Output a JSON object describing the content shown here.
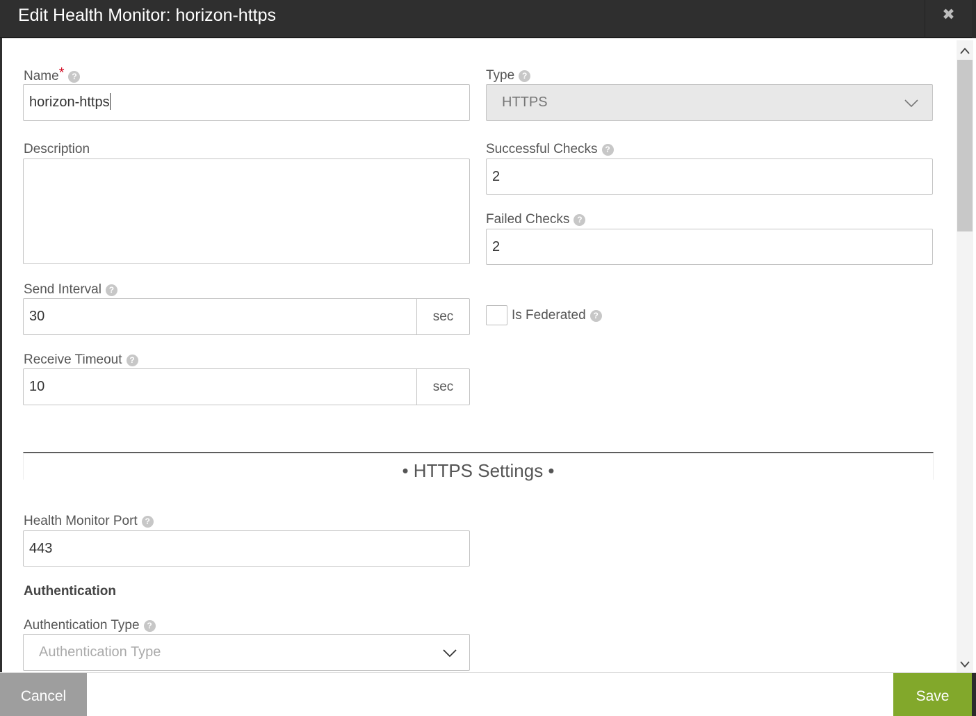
{
  "dialog": {
    "title": "Edit Health Monitor: horizon-https",
    "close_glyph": "✖"
  },
  "form": {
    "name": {
      "label": "Name",
      "required_mark": "*",
      "value": "horizon-https"
    },
    "type": {
      "label": "Type",
      "value": "HTTPS"
    },
    "description": {
      "label": "Description",
      "value": ""
    },
    "successful_checks": {
      "label": "Successful Checks",
      "value": "2"
    },
    "failed_checks": {
      "label": "Failed Checks",
      "value": "2"
    },
    "send_interval": {
      "label": "Send Interval",
      "value": "30",
      "unit": "sec"
    },
    "is_federated": {
      "label": "Is Federated",
      "checked": false
    },
    "receive_timeout": {
      "label": "Receive Timeout",
      "value": "10",
      "unit": "sec"
    }
  },
  "https_settings": {
    "section_title": "• HTTPS Settings •",
    "port": {
      "label": "Health Monitor Port",
      "value": "443"
    },
    "authentication_heading": "Authentication",
    "auth_type": {
      "label": "Authentication Type",
      "placeholder": "Authentication Type"
    }
  },
  "footer": {
    "cancel_label": "Cancel",
    "save_label": "Save"
  },
  "help_glyph": "?",
  "colors": {
    "header_bg": "#2f2f2f",
    "save_bg": "#82a82b",
    "cancel_bg": "#9e9e9e",
    "required": "#d0021b"
  }
}
